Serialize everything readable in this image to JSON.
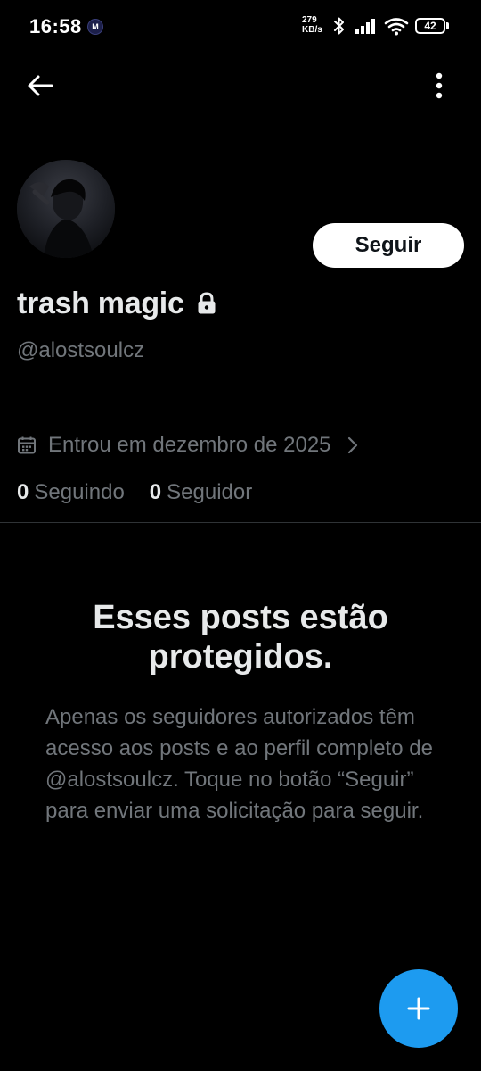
{
  "status_bar": {
    "time": "16:58",
    "notification_icon": "M",
    "net_speed_value": "279",
    "net_speed_unit": "KB/s",
    "battery": "42",
    "icons": [
      "bluetooth-icon",
      "signal-icon",
      "wifi-icon",
      "battery-icon"
    ]
  },
  "nav": {
    "back_icon": "arrow-left-icon",
    "more_icon": "more-vertical-icon"
  },
  "profile": {
    "display_name": "trash magic",
    "username": "@alostsoulcz",
    "protected": true,
    "follow_label": "Seguir",
    "joined": "Entrou em dezembro de 2025",
    "following_count": "0",
    "following_label": "Seguindo",
    "followers_count": "0",
    "followers_label": "Seguidor"
  },
  "protected_notice": {
    "title": "Esses posts estão protegidos.",
    "body": "Apenas os seguidores autorizados têm acesso aos posts e ao perfil completo de @alostsoulcz. Toque no botão “Seguir” para enviar uma solicitação para seguir."
  },
  "fab": {
    "icon": "plus-icon"
  },
  "colors": {
    "background": "#000000",
    "primary_text": "#e7e9ea",
    "secondary_text": "#71767b",
    "accent": "#1d9bf0",
    "divider": "#2f3336",
    "follow_button_bg": "#ffffff"
  }
}
